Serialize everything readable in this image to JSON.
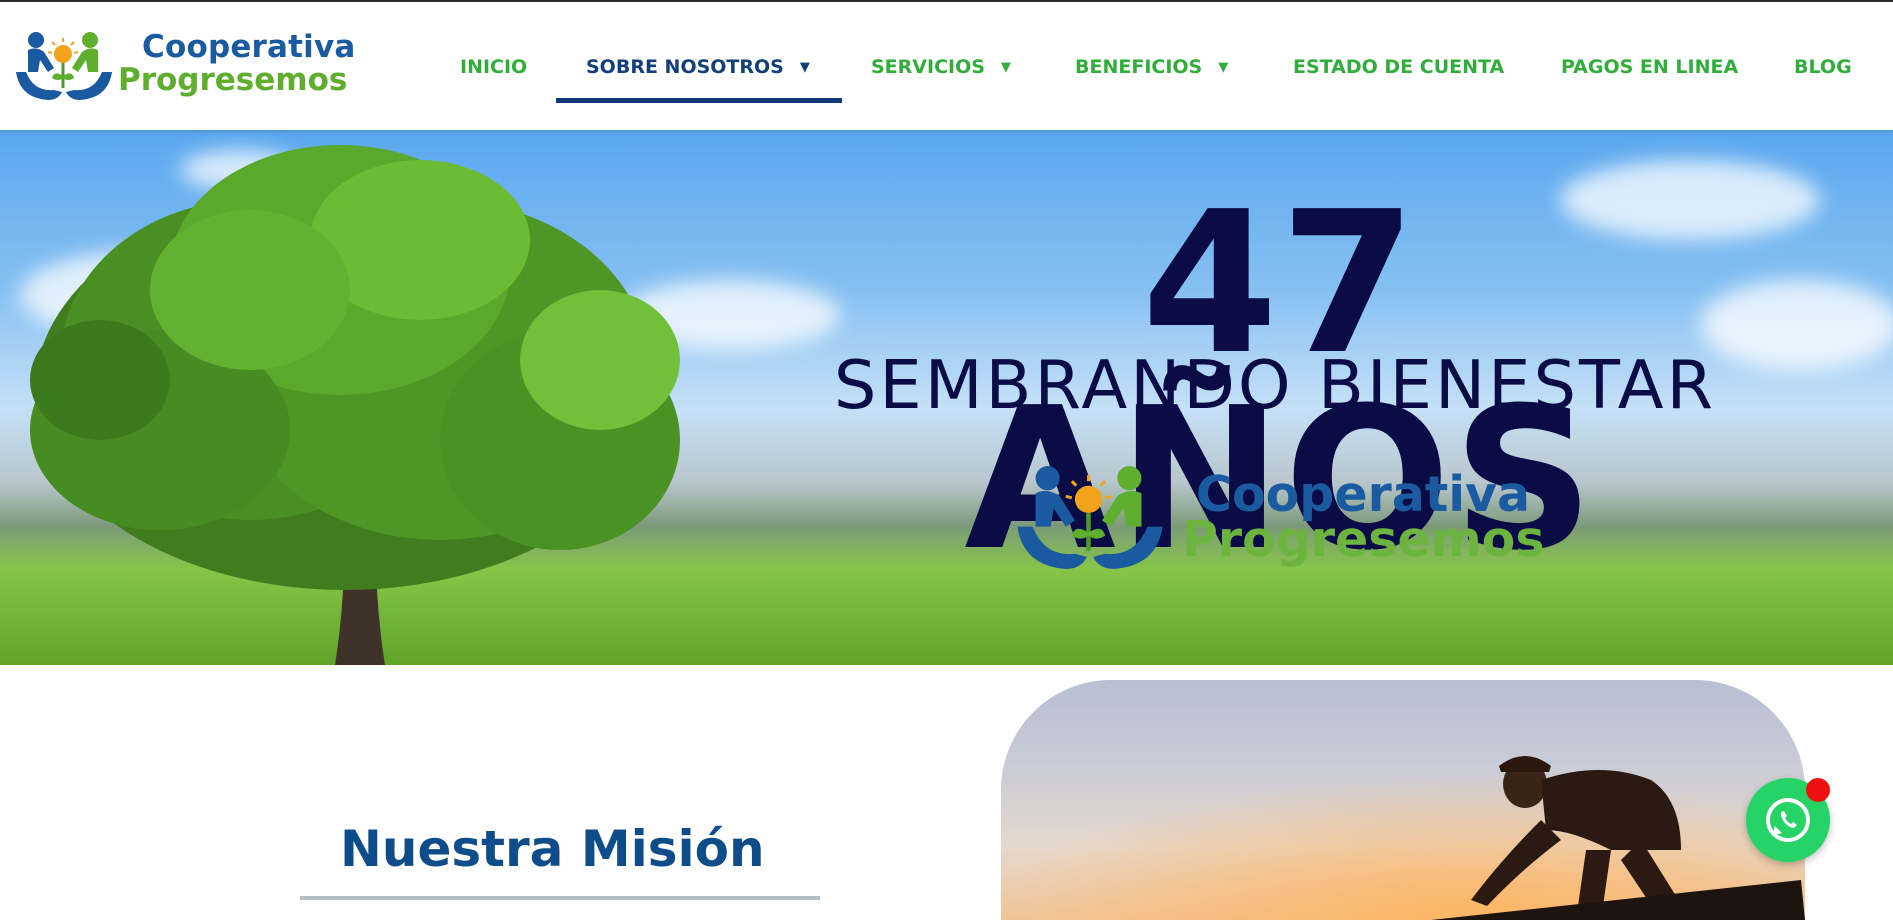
{
  "brand": {
    "name_line1": "Cooperativa",
    "name_line2": "Progresemos",
    "blue": "#1a5aa0",
    "green": "#5fae2e"
  },
  "nav": {
    "items": [
      {
        "label": "INICIO",
        "has_dropdown": false,
        "active": false
      },
      {
        "label": "SOBRE NOSOTROS",
        "has_dropdown": true,
        "active": true
      },
      {
        "label": "SERVICIOS",
        "has_dropdown": true,
        "active": false
      },
      {
        "label": "BENEFICIOS",
        "has_dropdown": true,
        "active": false
      },
      {
        "label": "ESTADO DE CUENTA",
        "has_dropdown": false,
        "active": false
      },
      {
        "label": "PAGOS EN LINEA",
        "has_dropdown": false,
        "active": false
      },
      {
        "label": "BLOG",
        "has_dropdown": false,
        "active": false
      }
    ],
    "caret": "▼",
    "item_color": "#2fae3a",
    "active_color": "#123f7a"
  },
  "hero": {
    "title": "47 AÑOS",
    "subtitle": "SEMBRANDO BIENESTAR",
    "logo_line1": "Cooperativa",
    "logo_line2": "Progresemos",
    "text_color": "#0b0c45"
  },
  "mission": {
    "title": "Nuestra Misión"
  },
  "whatsapp": {
    "icon": "whatsapp-icon",
    "color": "#25d366",
    "badge_color": "#ef1010"
  }
}
